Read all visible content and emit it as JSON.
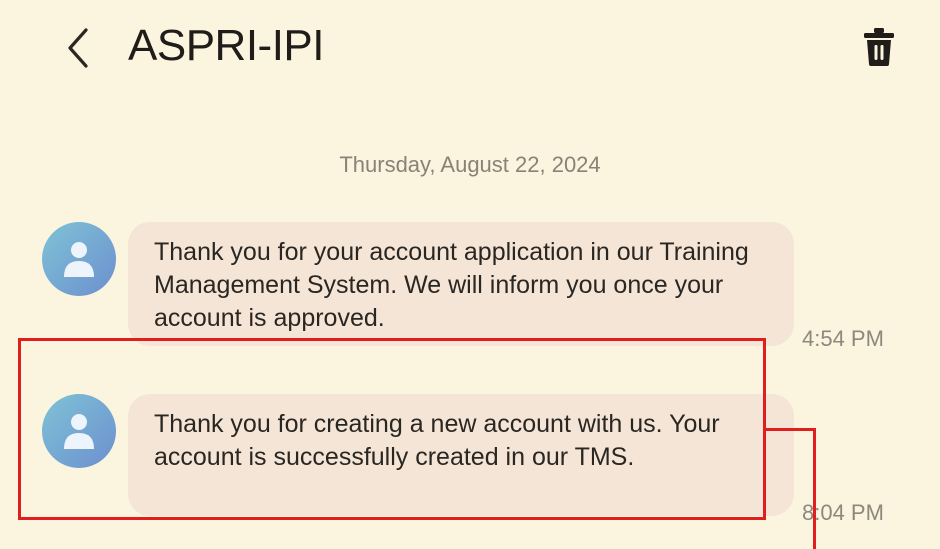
{
  "header": {
    "back_icon": "chevron-left-icon",
    "title": "ASPRI-IPI",
    "delete_icon": "trash-icon"
  },
  "conversation": {
    "date": "Thursday, August 22, 2024",
    "messages": [
      {
        "avatar_icon": "person-icon",
        "text": "Thank you for your account application in our Training Management System. We will inform you once your account is approved.",
        "time": "4:54 PM"
      },
      {
        "avatar_icon": "person-icon",
        "text": "Thank you for creating a new account with us. Your account is successfully created in our TMS.",
        "time": "8:04 PM"
      }
    ]
  },
  "colors": {
    "background": "#fbf5df",
    "bubble": "#f4e5d6",
    "annotation": "#e21d1d"
  }
}
